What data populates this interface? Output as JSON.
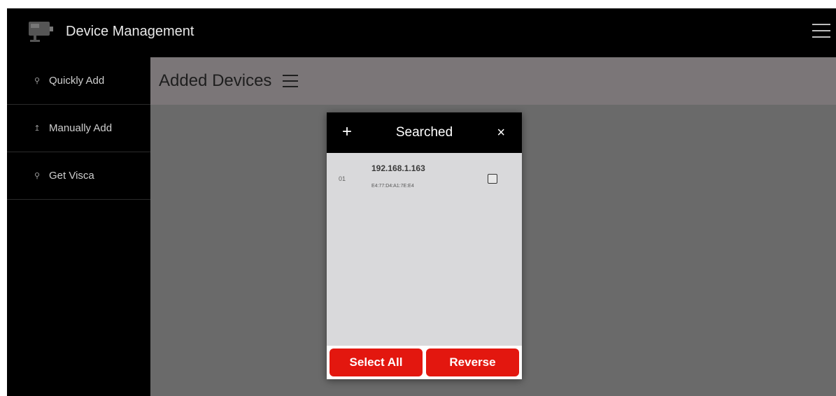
{
  "app": {
    "title": "Device Management",
    "logo_icon": "camera-icon",
    "menu_icon": "hamburger-menu-icon"
  },
  "sidebar": {
    "items": [
      {
        "label": "Quickly Add",
        "icon": "search-icon"
      },
      {
        "label": "Manually Add",
        "icon": "tool-icon"
      },
      {
        "label": "Get Visca",
        "icon": "search-icon"
      }
    ]
  },
  "main": {
    "title": "Added Devices",
    "menu_icon": "hamburger-menu-icon"
  },
  "dialog": {
    "title": "Searched",
    "add_symbol": "+",
    "close_symbol": "×",
    "devices": [
      {
        "index": "01",
        "ip": "192.168.1.163",
        "mac": "E4:77:D4:A1:7E:E4",
        "checked": false
      }
    ],
    "buttons": {
      "select_all": "Select All",
      "reverse": "Reverse"
    }
  },
  "colors": {
    "accent_red": "#e3170f",
    "header_black": "#000000",
    "main_background": "#6a6a6a",
    "dialog_background": "#d9d9db"
  }
}
